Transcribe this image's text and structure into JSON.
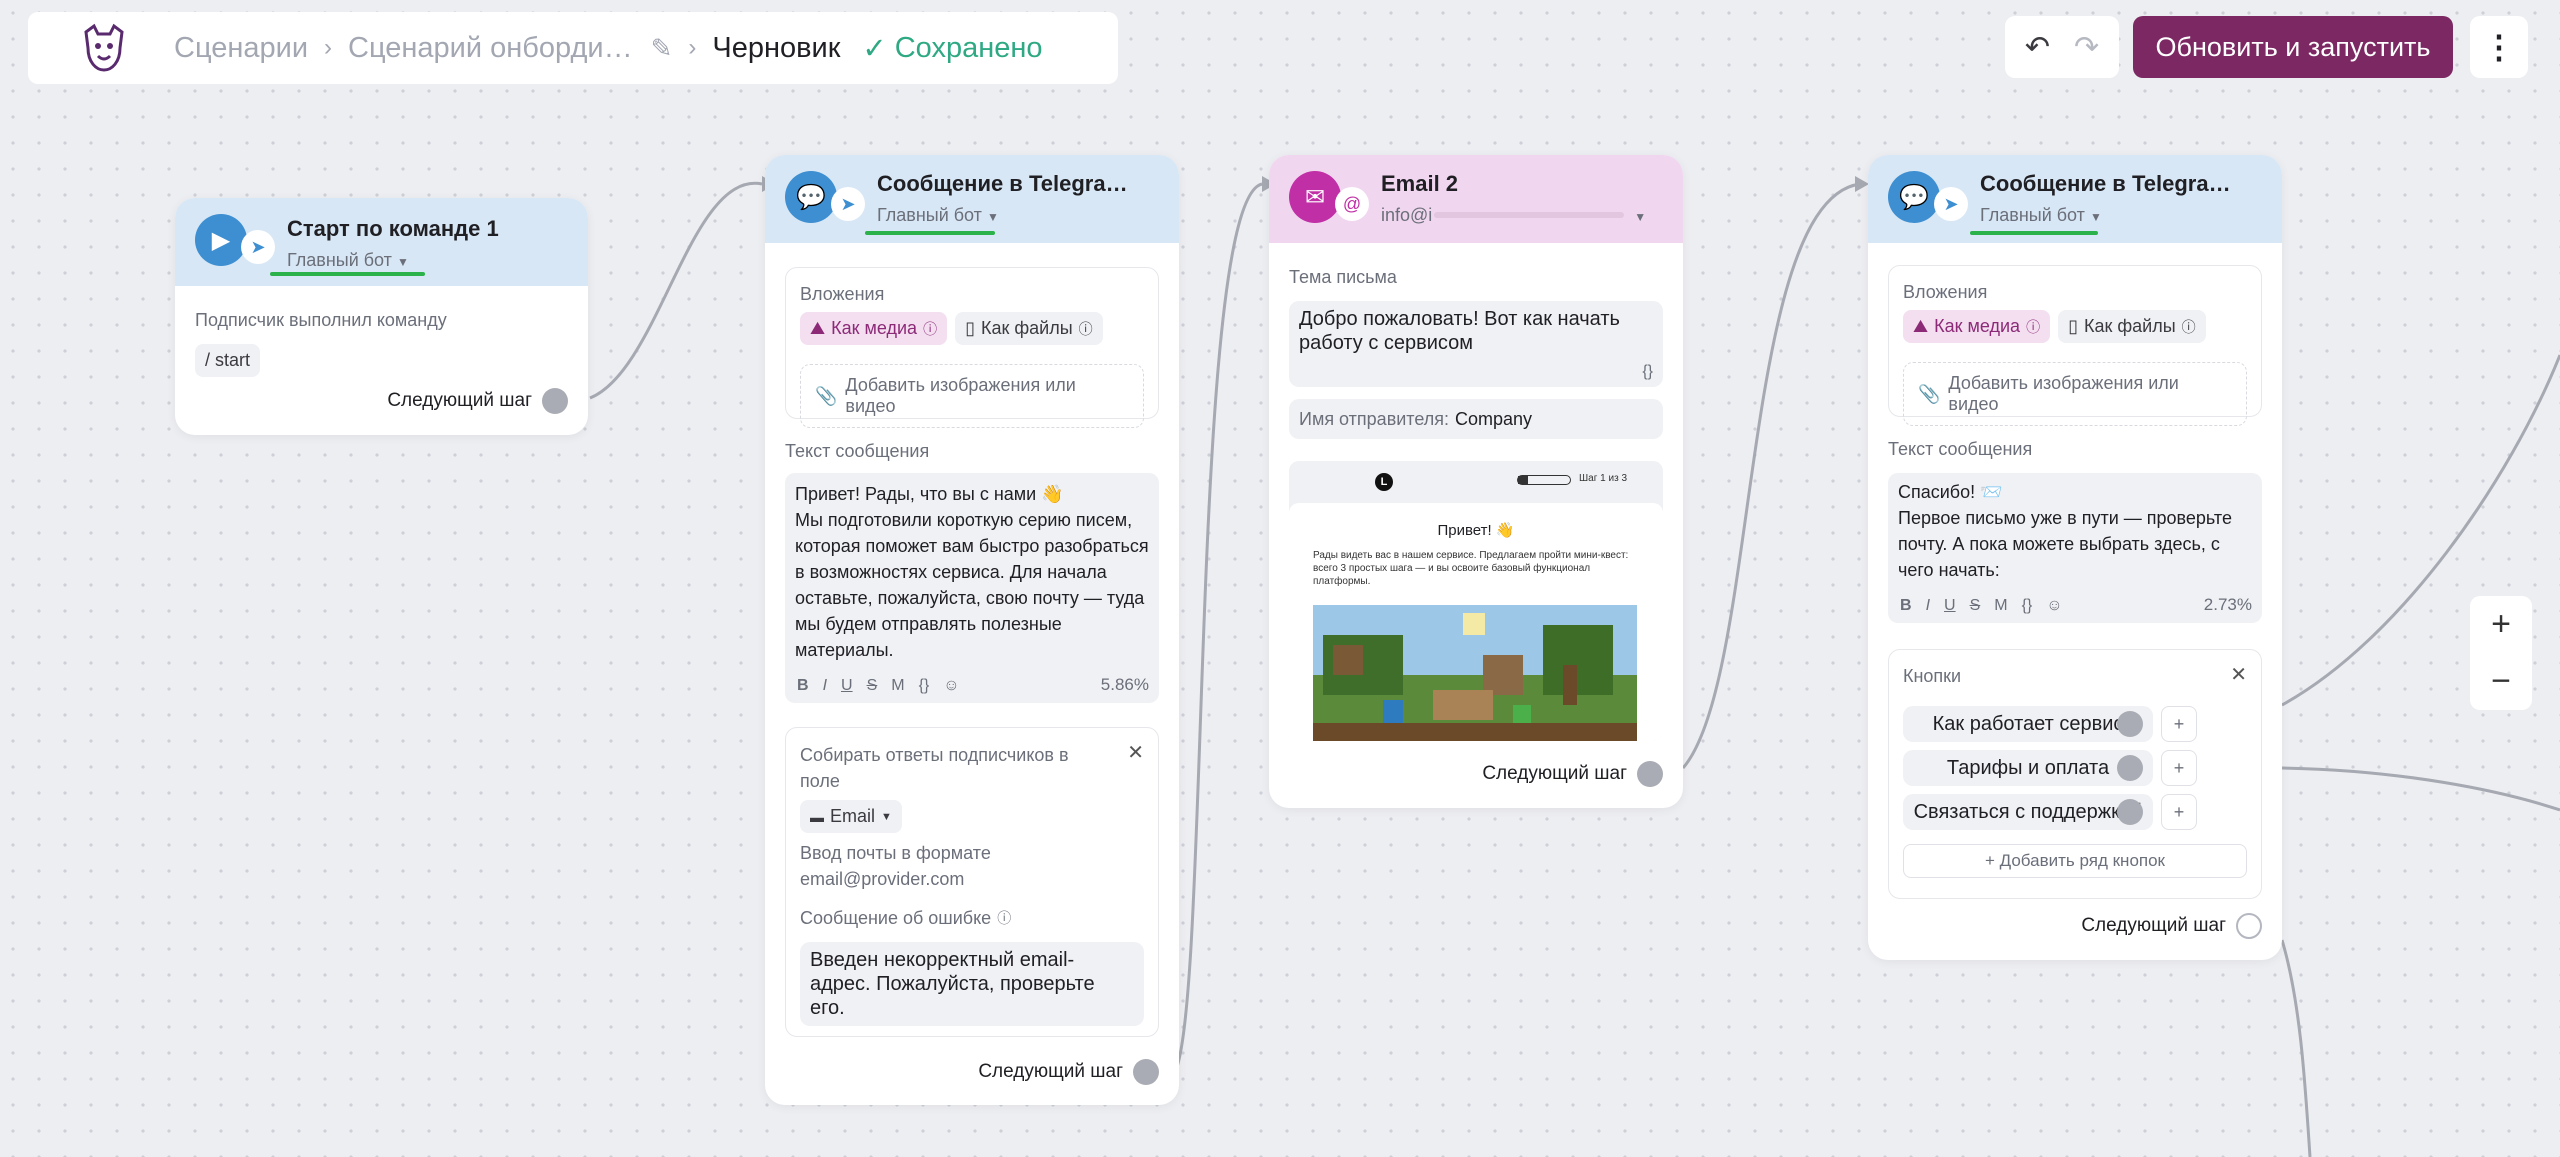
{
  "topbar": {
    "crumb1": "Сценарии",
    "crumb2": "Сценарий онборди…",
    "crumb3": "Черновик",
    "saved": "Сохранено"
  },
  "actions": {
    "run": "Обновить и запустить",
    "more": "⋮",
    "undo": "↶",
    "redo": "↷"
  },
  "zoom": {
    "in": "+",
    "out": "−"
  },
  "node1": {
    "title": "Старт по команде 1",
    "bot": "Главный бот",
    "label": "Подписчик выполнил команду",
    "command": "/ start",
    "next": "Следующий шаг"
  },
  "node2": {
    "title": "Сообщение в Telegra…",
    "bot": "Главный бот",
    "attach_label": "Вложения",
    "as_media": "Как медиа",
    "as_files": "Как файлы",
    "add_media": "Добавить изображения или видео",
    "text_label": "Текст сообщения",
    "text": "Привет! Рады, что вы с нами 👋\nМы подготовили короткую серию писем, которая поможет вам быстро разобраться в возможностях сервиса. Для начала оставьте, пожалуйста, свою почту — туда мы будем отправлять полезные материалы.",
    "percent": "5.86%",
    "collect_label": "Собирать ответы подписчиков в поле",
    "field": "Email",
    "format_hint": "Ввод почты в формате email@provider.com",
    "error_label": "Сообщение об ошибке",
    "error_text": "Введен некорректный email-адрес. Пожалуйста, проверьте его.",
    "next": "Следующий шаг"
  },
  "node3": {
    "title": "Email 2",
    "from": "info@i",
    "subject_label": "Тема письма",
    "subject": "Добро пожаловать! Вот как начать работу с сервисом",
    "braces": "{}",
    "sender_label": "Имя отправителя:",
    "sender": "Company",
    "preview_logo": "L",
    "preview_step": "Шаг 1 из 3",
    "preview_hello": "Привет! 👋",
    "preview_body": "Рады видеть вас в нашем сервисе. Предлагаем пройти мини-квест: всего 3 простых шага — и вы освоите базовый функционал платформы.",
    "next": "Следующий шаг"
  },
  "node4": {
    "title": "Сообщение в Telegra…",
    "bot": "Главный бот",
    "attach_label": "Вложения",
    "as_media": "Как медиа",
    "as_files": "Как файлы",
    "add_media": "Добавить изображения или видео",
    "text_label": "Текст сообщения",
    "text": "Спасибо! 📨\nПервое письмо уже в пути — проверьте почту. А пока можете выбрать здесь, с чего начать:",
    "percent": "2.73%",
    "buttons_label": "Кнопки",
    "buttons": [
      "Как работает сервис",
      "Тарифы и оплата",
      "Связаться с поддержкой"
    ],
    "add_row": "+ Добавить ряд кнопок",
    "next": "Следующий шаг"
  },
  "format_tools": [
    "B",
    "I",
    "U",
    "S",
    "M",
    "{}",
    "☺"
  ],
  "colors": {
    "accent": "#7c2863",
    "saved": "#2fa983",
    "telegram_head": "#d8e7f5",
    "email_head": "#f1d6f0"
  }
}
